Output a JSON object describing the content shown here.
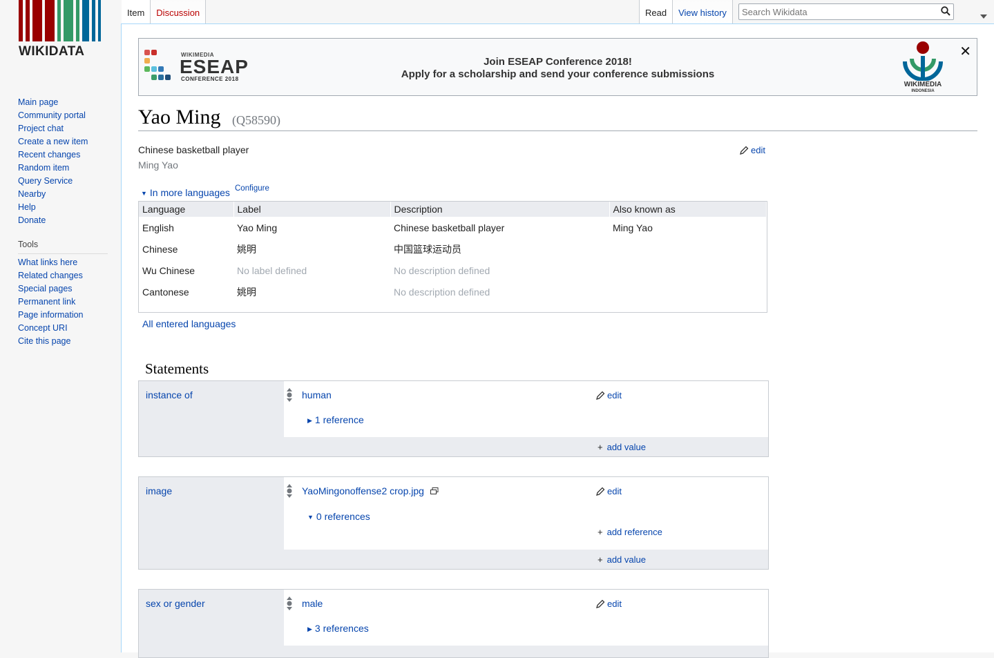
{
  "site": {
    "logo_text": "WIKIDATA"
  },
  "sidebar": {
    "nav": [
      "Main page",
      "Community portal",
      "Project chat",
      "Create a new item",
      "Recent changes",
      "Random item",
      "Query Service",
      "Nearby",
      "Help",
      "Donate"
    ],
    "tools_heading": "Tools",
    "tools": [
      "What links here",
      "Related changes",
      "Special pages",
      "Permanent link",
      "Page information",
      "Concept URI",
      "Cite this page"
    ]
  },
  "tabs": {
    "item": "Item",
    "discussion": "Discussion",
    "read": "Read",
    "view_history": "View history"
  },
  "search": {
    "placeholder": "Search Wikidata"
  },
  "banner": {
    "eseap_small": "WIKIMEDIA",
    "eseap_big": "ESEAP",
    "eseap_conf": "CONFERENCE 2018",
    "line1": "Join ESEAP Conference 2018!",
    "line2": "Apply for a scholarship and send your conference submissions",
    "wmi_text": "WIKIMEDIA",
    "wmi_sub": "INDONESIA",
    "close": "✕"
  },
  "item": {
    "label": "Yao Ming",
    "id": "(Q58590)",
    "description": "Chinese basketball player",
    "alias": "Ming Yao",
    "edit": "edit"
  },
  "languages": {
    "toggle": "In more languages",
    "configure": "Configure",
    "headers": [
      "Language",
      "Label",
      "Description",
      "Also known as"
    ],
    "rows": [
      {
        "language": "English",
        "label": "Yao Ming",
        "description": "Chinese basketball player",
        "aliases": "Ming Yao"
      },
      {
        "language": "Chinese",
        "label": "姚明",
        "description": "中国篮球运动员",
        "aliases": ""
      },
      {
        "language": "Wu Chinese",
        "label": "No label defined",
        "description": "No description defined",
        "aliases": ""
      },
      {
        "language": "Cantonese",
        "label": "姚明",
        "description": "No description defined",
        "aliases": ""
      }
    ],
    "all_entered": "All entered languages"
  },
  "statements": {
    "heading": "Statements",
    "edit": "edit",
    "add_value": "add value",
    "add_reference": "add reference",
    "groups": [
      {
        "property": "instance of",
        "value": "human",
        "refs": "1 reference"
      },
      {
        "property": "image",
        "value": "YaoMingonoffense2 crop.jpg",
        "refs": "0 references"
      },
      {
        "property": "sex or gender",
        "value": "male",
        "refs": "3 references"
      }
    ]
  }
}
